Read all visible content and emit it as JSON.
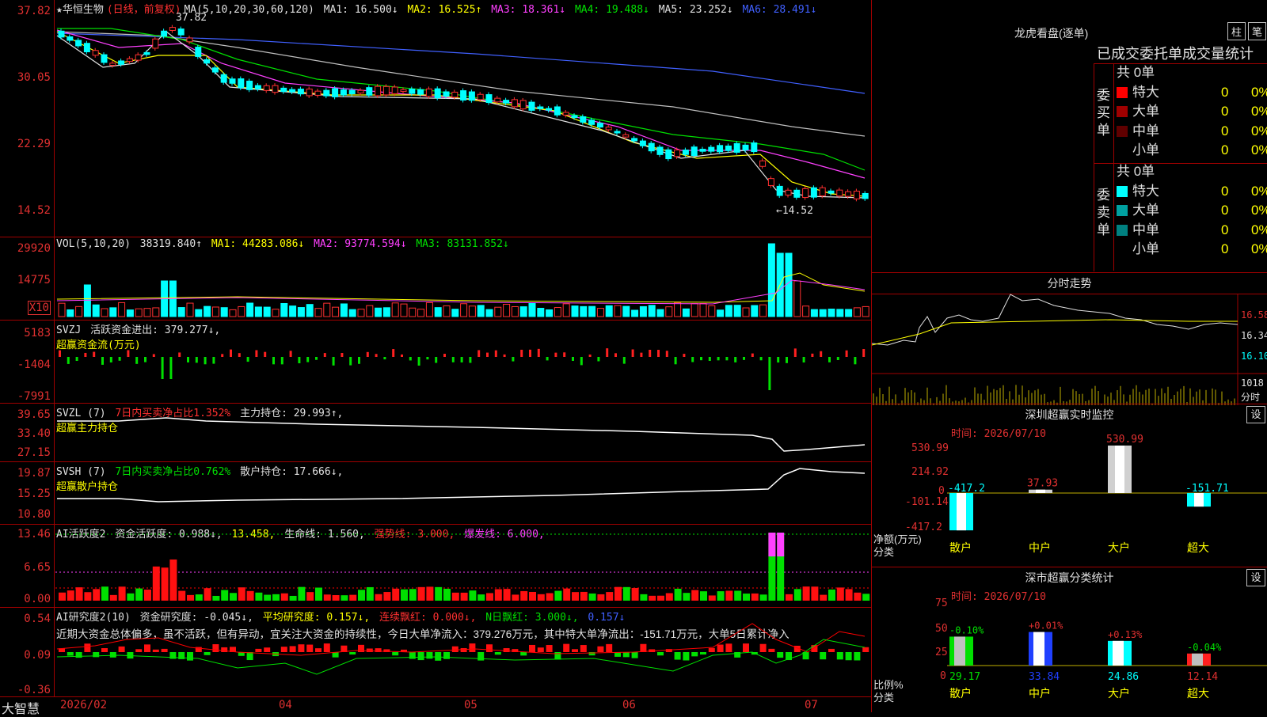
{
  "app": {
    "brand": "大智慧"
  },
  "stock": {
    "name": "★华恒生物",
    "period": "(日线，前复权)",
    "ma_header": "MA(5,10,20,30,60,120)"
  },
  "main_chart": {
    "y_labels": [
      "37.82",
      "30.05",
      "22.29",
      "14.52"
    ],
    "ma_values": [
      {
        "label": "MA1: 16.500↓",
        "color": "#e0e0e0"
      },
      {
        "label": "MA2: 16.525↑",
        "color": "#ffff00"
      },
      {
        "label": "MA3: 18.361↓",
        "color": "#ff40ff"
      },
      {
        "label": "MA4: 19.488↓",
        "color": "#00e000"
      },
      {
        "label": "MA5: 23.252↓",
        "color": "#c0c0c0"
      },
      {
        "label": "MA6: 28.491↓",
        "color": "#4060ff"
      }
    ],
    "high_label": "37.82",
    "low_label": "←14.52"
  },
  "vol": {
    "header": "VOL(5,10,20)",
    "value": "38319.840↑",
    "ma1": "MA1: 44283.086↓",
    "ma2": "MA2: 93774.594↓",
    "ma3": "MA3: 83131.852↓",
    "y_labels": [
      "29920",
      "14775"
    ],
    "unit": "X10"
  },
  "svzj": {
    "header": "SVZJ",
    "title": "活跃资金进出: 379.277↓,",
    "subtitle": "超赢资金流(万元)",
    "y_labels": [
      "5183",
      "-1404",
      "-7991"
    ]
  },
  "svzl": {
    "header": "SVZL (7)",
    "ratio": "7日内买卖净占比1.352%",
    "hold": "主力持仓: 29.993↑,",
    "subtitle": "超赢主力持仓",
    "y_labels": [
      "39.65",
      "33.40",
      "27.15"
    ]
  },
  "svsh": {
    "header": "SVSH (7)",
    "ratio": "7日内买卖净占比0.762%",
    "hold": "散户持仓: 17.666↓,",
    "subtitle": "超赢散户持仓",
    "y_labels": [
      "19.87",
      "15.25",
      "10.80"
    ]
  },
  "ai_active": {
    "header": "AI活跃度2",
    "v1": "资金活跃度: 0.988↓,",
    "v2": "13.458,",
    "v3": "生命线: 1.560,",
    "v4": "强势线: 3.000,",
    "v5": "爆发线: 6.000,",
    "y_labels": [
      "13.46",
      "6.65",
      "0.00"
    ]
  },
  "ai_research": {
    "header": "AI研究度2(10)",
    "v1": "资金研究度: -0.045↓,",
    "v2": "平均研究度: 0.157↓,",
    "v3": "连续飘红: 0.000↓,",
    "v4": "N日飘红: 3.000↓,",
    "v5": "0.157↓",
    "text": "近期大资金总体偏多，虽不活跃，但有异动，宜关注大资金的持续性，今日大单净流入：379.276万元，其中特大单净流出：-151.71万元，大单5日累计净入",
    "y_labels": [
      "0.54",
      "0.09",
      "-0.36"
    ]
  },
  "x_axis": {
    "labels": [
      "2026/02",
      "04",
      "05",
      "06",
      "07"
    ]
  },
  "lhb": {
    "title": "龙虎看盘(逐单)",
    "tab_bar": "柱",
    "tab_pen": "笔",
    "header": "已成交委托单成交量统计",
    "buy": {
      "label": "委买单",
      "total": "共 0单",
      "rows": [
        {
          "name": "特大",
          "color": "#ff0000",
          "v": "0",
          "p": "0%"
        },
        {
          "name": "大单",
          "color": "#a00000",
          "v": "0",
          "p": "0%"
        },
        {
          "name": "中单",
          "color": "#600000",
          "v": "0",
          "p": "0%"
        },
        {
          "name": "小单",
          "color": "#000000",
          "v": "0",
          "p": "0%"
        }
      ]
    },
    "sell": {
      "label": "委卖单",
      "total": "共 0单",
      "rows": [
        {
          "name": "特大",
          "color": "#00ffff",
          "v": "0",
          "p": "0%"
        },
        {
          "name": "大单",
          "color": "#00a0a0",
          "v": "0",
          "p": "0%"
        },
        {
          "name": "中单",
          "color": "#008080",
          "v": "0",
          "p": "0%"
        },
        {
          "name": "小单",
          "color": "#000000",
          "v": "0",
          "p": "0%"
        }
      ]
    }
  },
  "intraday": {
    "title": "分时走势",
    "y_labels": [
      "16.58",
      "16.34",
      "16.10"
    ],
    "vol_label": "1018",
    "vol_unit": "分时"
  },
  "sz_monitor": {
    "title": "深圳超赢实时监控",
    "gear": "设",
    "time": "时间: 2026/07/10",
    "axis_label": "净额(万元)",
    "axis_label2": "分类",
    "y_labels": [
      "530.99",
      "214.92",
      "0",
      "-101.14",
      "-417.2"
    ],
    "chart_data": {
      "type": "bar",
      "categories": [
        "散户",
        "中户",
        "大户",
        "超大"
      ],
      "values": [
        -417.2,
        37.93,
        530.99,
        -151.71
      ],
      "value_labels": [
        "-417.2",
        "37.93",
        "530.99",
        "-151.71"
      ]
    }
  },
  "sz_class": {
    "title": "深市超赢分类统计",
    "gear": "设",
    "time": "时间: 2026/07/10",
    "axis_label": "比例%",
    "axis_label2": "分类",
    "y_labels": [
      "75",
      "50",
      "25",
      "0"
    ],
    "chart_data": {
      "type": "bar",
      "categories": [
        "散户",
        "中户",
        "大户",
        "超大"
      ],
      "values": [
        29.17,
        33.84,
        24.86,
        12.14
      ],
      "changes": [
        "-0.10%",
        "+0.01%",
        "+0.13%",
        "-0.04%"
      ],
      "value_labels": [
        "29.17",
        "33.84",
        "24.86",
        "12.14"
      ]
    }
  }
}
